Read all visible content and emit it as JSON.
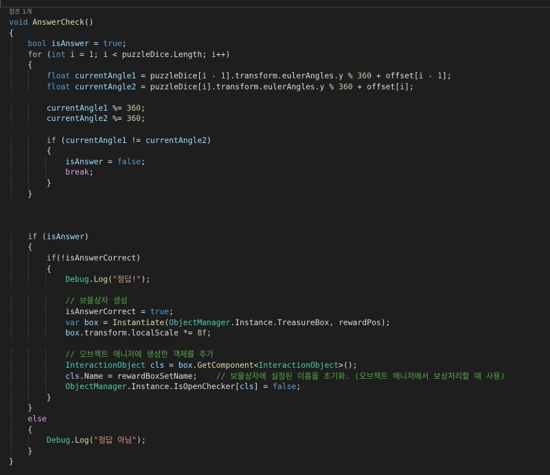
{
  "codelens": "참조 1개",
  "lines": [
    [
      {
        "t": "kw",
        "v": "void"
      },
      {
        "t": "pl",
        "v": " "
      },
      {
        "t": "fn",
        "v": "AnswerCheck"
      },
      {
        "t": "pl",
        "v": "()"
      }
    ],
    [
      {
        "t": "pl",
        "v": "{"
      }
    ],
    [
      {
        "t": "pl",
        "v": "    "
      },
      {
        "t": "kw",
        "v": "bool"
      },
      {
        "t": "pl",
        "v": " "
      },
      {
        "t": "var",
        "v": "isAnswer"
      },
      {
        "t": "pl",
        "v": " = "
      },
      {
        "t": "kw",
        "v": "true"
      },
      {
        "t": "pl",
        "v": ";"
      }
    ],
    [
      {
        "t": "pl",
        "v": "    "
      },
      {
        "t": "ctl",
        "v": "for"
      },
      {
        "t": "pl",
        "v": " ("
      },
      {
        "t": "kw",
        "v": "int"
      },
      {
        "t": "pl",
        "v": " "
      },
      {
        "t": "var",
        "v": "i"
      },
      {
        "t": "pl",
        "v": " = "
      },
      {
        "t": "num",
        "v": "1"
      },
      {
        "t": "pl",
        "v": "; "
      },
      {
        "t": "var",
        "v": "i"
      },
      {
        "t": "pl",
        "v": " < puzzleDice.Length; "
      },
      {
        "t": "var",
        "v": "i"
      },
      {
        "t": "pl",
        "v": "++)"
      }
    ],
    [
      {
        "t": "pl",
        "v": "    {"
      }
    ],
    [
      {
        "t": "pl",
        "v": "        "
      },
      {
        "t": "kw",
        "v": "float"
      },
      {
        "t": "pl",
        "v": " "
      },
      {
        "t": "var",
        "v": "currentAngle1"
      },
      {
        "t": "pl",
        "v": " = puzzleDice["
      },
      {
        "t": "var",
        "v": "i"
      },
      {
        "t": "pl",
        "v": " - "
      },
      {
        "t": "num",
        "v": "1"
      },
      {
        "t": "pl",
        "v": "].transform.eulerAngles.y % "
      },
      {
        "t": "num",
        "v": "360"
      },
      {
        "t": "pl",
        "v": " + offset["
      },
      {
        "t": "var",
        "v": "i"
      },
      {
        "t": "pl",
        "v": " - "
      },
      {
        "t": "num",
        "v": "1"
      },
      {
        "t": "pl",
        "v": "];"
      }
    ],
    [
      {
        "t": "pl",
        "v": "        "
      },
      {
        "t": "kw",
        "v": "float"
      },
      {
        "t": "pl",
        "v": " "
      },
      {
        "t": "var",
        "v": "currentAngle2"
      },
      {
        "t": "pl",
        "v": " = puzzleDice["
      },
      {
        "t": "var",
        "v": "i"
      },
      {
        "t": "pl",
        "v": "].transform.eulerAngles.y % "
      },
      {
        "t": "num",
        "v": "360"
      },
      {
        "t": "pl",
        "v": " + offset["
      },
      {
        "t": "var",
        "v": "i"
      },
      {
        "t": "pl",
        "v": "];"
      }
    ],
    [],
    [
      {
        "t": "pl",
        "v": "        "
      },
      {
        "t": "var",
        "v": "currentAngle1"
      },
      {
        "t": "pl",
        "v": " %= "
      },
      {
        "t": "num",
        "v": "360"
      },
      {
        "t": "pl",
        "v": ";"
      }
    ],
    [
      {
        "t": "pl",
        "v": "        "
      },
      {
        "t": "var",
        "v": "currentAngle2"
      },
      {
        "t": "pl",
        "v": " %= "
      },
      {
        "t": "num",
        "v": "360"
      },
      {
        "t": "pl",
        "v": ";"
      }
    ],
    [],
    [
      {
        "t": "pl",
        "v": "        "
      },
      {
        "t": "ctl",
        "v": "if"
      },
      {
        "t": "pl",
        "v": " ("
      },
      {
        "t": "var",
        "v": "currentAngle1"
      },
      {
        "t": "pl",
        "v": " != "
      },
      {
        "t": "var",
        "v": "currentAngle2"
      },
      {
        "t": "pl",
        "v": ")"
      }
    ],
    [
      {
        "t": "pl",
        "v": "        {"
      }
    ],
    [
      {
        "t": "pl",
        "v": "            "
      },
      {
        "t": "var",
        "v": "isAnswer"
      },
      {
        "t": "pl",
        "v": " = "
      },
      {
        "t": "kw",
        "v": "false"
      },
      {
        "t": "pl",
        "v": ";"
      }
    ],
    [
      {
        "t": "pl",
        "v": "            "
      },
      {
        "t": "ctl",
        "v": "break"
      },
      {
        "t": "pl",
        "v": ";"
      }
    ],
    [
      {
        "t": "pl",
        "v": "        }"
      }
    ],
    [
      {
        "t": "pl",
        "v": "    }"
      }
    ],
    [],
    [],
    [],
    [
      {
        "t": "pl",
        "v": "    "
      },
      {
        "t": "ctl",
        "v": "if"
      },
      {
        "t": "pl",
        "v": " ("
      },
      {
        "t": "var",
        "v": "isAnswer"
      },
      {
        "t": "pl",
        "v": ")"
      }
    ],
    [
      {
        "t": "pl",
        "v": "    {"
      }
    ],
    [
      {
        "t": "pl",
        "v": "        "
      },
      {
        "t": "ctl",
        "v": "if"
      },
      {
        "t": "pl",
        "v": "(!isAnswerCorrect)"
      }
    ],
    [
      {
        "t": "pl",
        "v": "        {"
      }
    ],
    [
      {
        "t": "pl",
        "v": "            "
      },
      {
        "t": "cls",
        "v": "Debug"
      },
      {
        "t": "pl",
        "v": "."
      },
      {
        "t": "fn",
        "v": "Log"
      },
      {
        "t": "pl",
        "v": "("
      },
      {
        "t": "str",
        "v": "\"정답!\""
      },
      {
        "t": "pl",
        "v": ");"
      }
    ],
    [],
    [
      {
        "t": "pl",
        "v": "            "
      },
      {
        "t": "cmt",
        "v": "// 보물상자 생성"
      }
    ],
    [
      {
        "t": "pl",
        "v": "            isAnswerCorrect = "
      },
      {
        "t": "kw",
        "v": "true"
      },
      {
        "t": "pl",
        "v": ";"
      }
    ],
    [
      {
        "t": "pl",
        "v": "            "
      },
      {
        "t": "kw",
        "v": "var"
      },
      {
        "t": "pl",
        "v": " "
      },
      {
        "t": "var",
        "v": "box"
      },
      {
        "t": "pl",
        "v": " = "
      },
      {
        "t": "fn",
        "v": "Instantiate"
      },
      {
        "t": "pl",
        "v": "("
      },
      {
        "t": "cls",
        "v": "ObjectManager"
      },
      {
        "t": "pl",
        "v": ".Instance.TreasureBox, rewardPos);"
      }
    ],
    [
      {
        "t": "pl",
        "v": "            "
      },
      {
        "t": "var",
        "v": "box"
      },
      {
        "t": "pl",
        "v": ".transform.localScale *= "
      },
      {
        "t": "num",
        "v": "8f"
      },
      {
        "t": "pl",
        "v": ";"
      }
    ],
    [],
    [
      {
        "t": "pl",
        "v": "            "
      },
      {
        "t": "cmt",
        "v": "// 오브젝트 매니저에 생성한 객체를 추가"
      }
    ],
    [
      {
        "t": "pl",
        "v": "            "
      },
      {
        "t": "cls",
        "v": "InteractionObject"
      },
      {
        "t": "pl",
        "v": " "
      },
      {
        "t": "var",
        "v": "cls"
      },
      {
        "t": "pl",
        "v": " = "
      },
      {
        "t": "var",
        "v": "box"
      },
      {
        "t": "pl",
        "v": "."
      },
      {
        "t": "fn",
        "v": "GetComponent"
      },
      {
        "t": "pl",
        "v": "<"
      },
      {
        "t": "cls",
        "v": "InteractionObject"
      },
      {
        "t": "pl",
        "v": ">();"
      }
    ],
    [
      {
        "t": "pl",
        "v": "            "
      },
      {
        "t": "var",
        "v": "cls"
      },
      {
        "t": "pl",
        "v": ".Name = rewardBoxSetName;    "
      },
      {
        "t": "cmt",
        "v": "// 보물상자에 설정된 이름을 초기화. (오브젝트 매니저에서 보상처리할 때 사용)"
      }
    ],
    [
      {
        "t": "pl",
        "v": "            "
      },
      {
        "t": "cls",
        "v": "ObjectManager"
      },
      {
        "t": "pl",
        "v": ".Instance.IsOpenChecker["
      },
      {
        "t": "var",
        "v": "cls"
      },
      {
        "t": "pl",
        "v": "] = "
      },
      {
        "t": "kw",
        "v": "false"
      },
      {
        "t": "pl",
        "v": ";"
      }
    ],
    [
      {
        "t": "pl",
        "v": "        }"
      }
    ],
    [
      {
        "t": "pl",
        "v": "    }"
      }
    ],
    [
      {
        "t": "pl",
        "v": "    "
      },
      {
        "t": "ctl",
        "v": "else"
      }
    ],
    [
      {
        "t": "pl",
        "v": "    {"
      }
    ],
    [
      {
        "t": "pl",
        "v": "        "
      },
      {
        "t": "cls",
        "v": "Debug"
      },
      {
        "t": "pl",
        "v": "."
      },
      {
        "t": "fn",
        "v": "Log"
      },
      {
        "t": "pl",
        "v": "("
      },
      {
        "t": "str",
        "v": "\"정답 아님\""
      },
      {
        "t": "pl",
        "v": ");"
      }
    ],
    [
      {
        "t": "pl",
        "v": "    }"
      }
    ],
    [
      {
        "t": "pl",
        "v": "}"
      }
    ]
  ]
}
